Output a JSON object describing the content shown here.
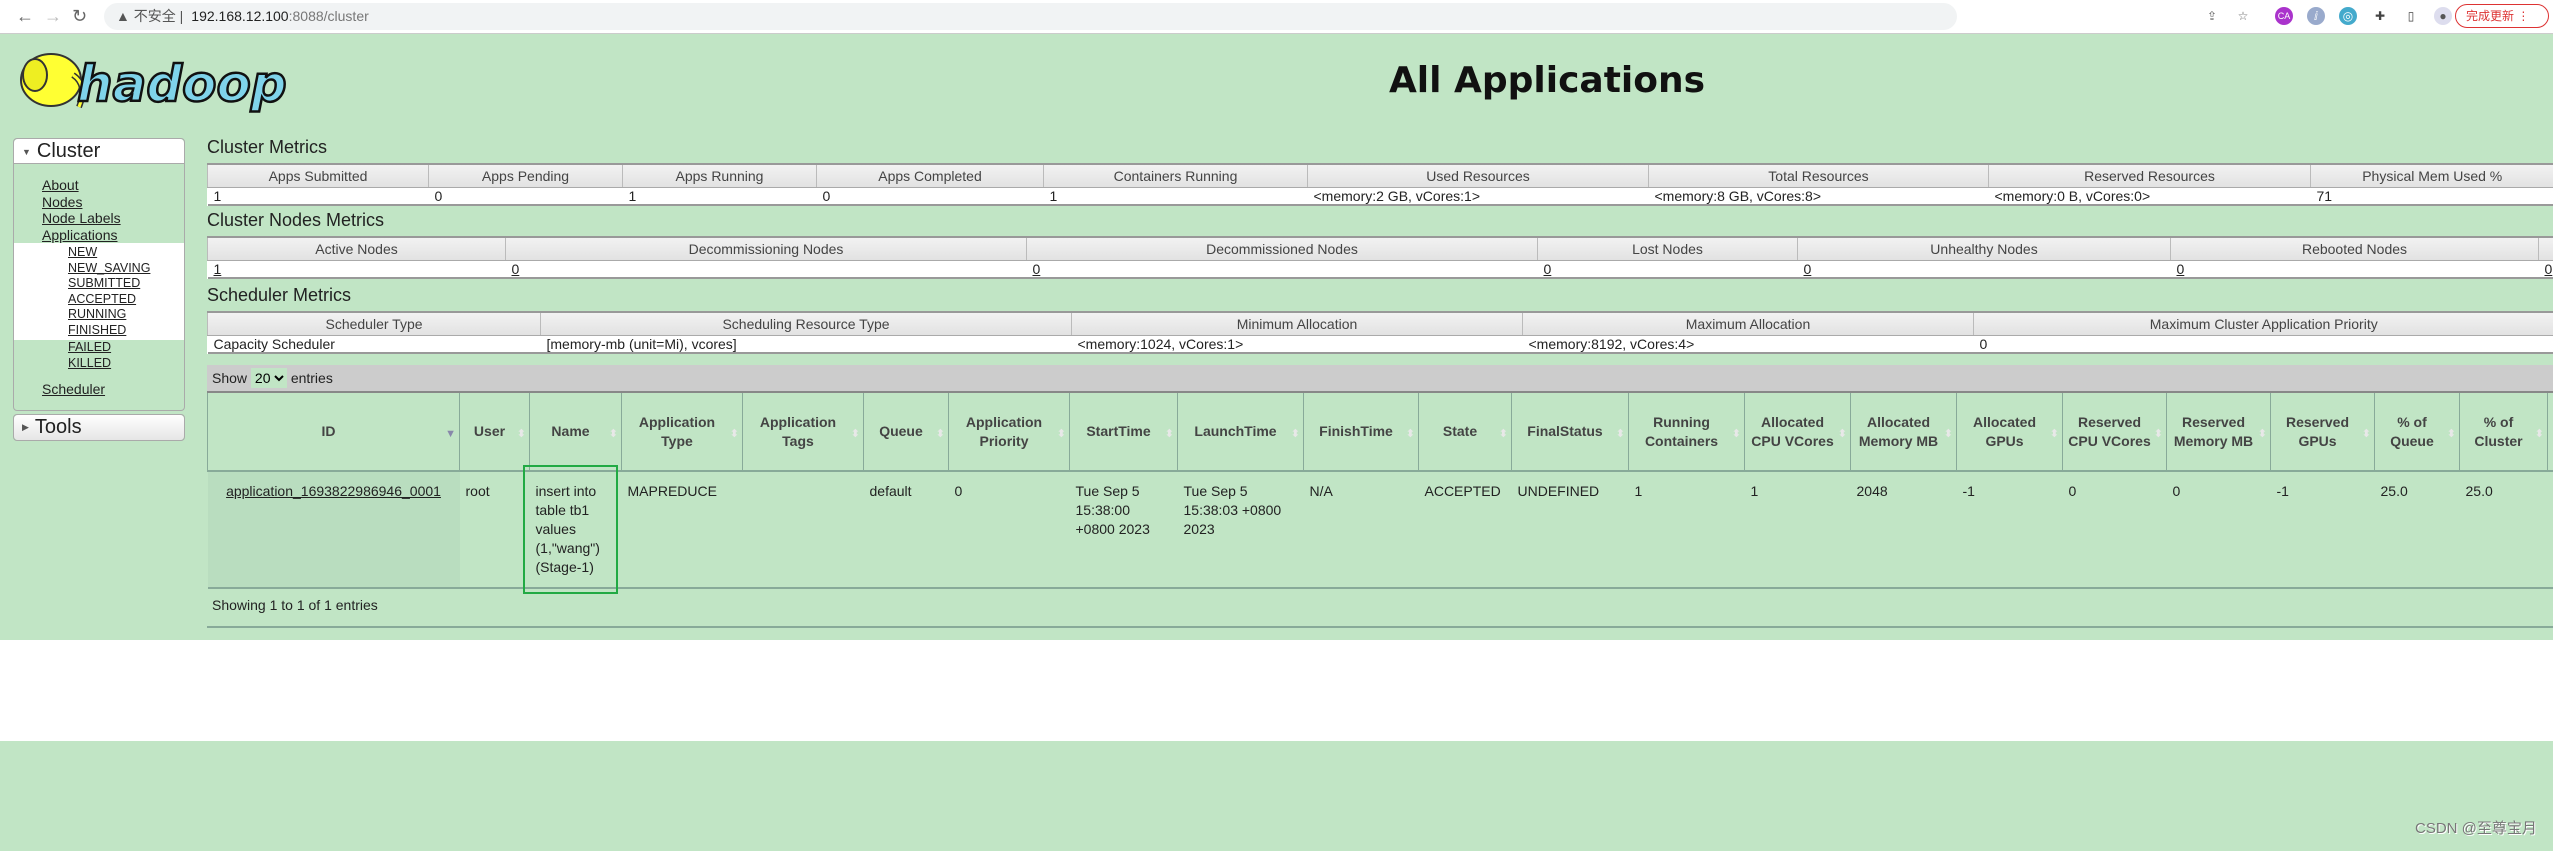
{
  "browser": {
    "insecure_label": "不安全",
    "url_host": "192.168.12.100",
    "url_path": ":8088/cluster",
    "update_button": "完成更新"
  },
  "logo_text": "hadoop",
  "page_title": "All Applications",
  "sidebar": {
    "cluster_label": "Cluster",
    "links": [
      "About",
      "Nodes",
      "Node Labels",
      "Applications"
    ],
    "app_states": [
      "NEW",
      "NEW_SAVING",
      "SUBMITTED",
      "ACCEPTED",
      "RUNNING",
      "FINISHED"
    ],
    "app_states2": [
      "FAILED",
      "KILLED"
    ],
    "scheduler": "Scheduler",
    "tools_label": "Tools"
  },
  "cluster_metrics": {
    "title": "Cluster Metrics",
    "headers": [
      "Apps Submitted",
      "Apps Pending",
      "Apps Running",
      "Apps Completed",
      "Containers Running",
      "Used Resources",
      "Total Resources",
      "Reserved Resources",
      "Physical Mem Used %"
    ],
    "values": [
      "1",
      "0",
      "1",
      "0",
      "1",
      "<memory:2 GB, vCores:1>",
      "<memory:8 GB, vCores:8>",
      "<memory:0 B, vCores:0>",
      "71"
    ]
  },
  "nodes_metrics": {
    "title": "Cluster Nodes Metrics",
    "headers": [
      "Active Nodes",
      "Decommissioning Nodes",
      "Decommissioned Nodes",
      "Lost Nodes",
      "Unhealthy Nodes",
      "Rebooted Nodes"
    ],
    "values": [
      "1",
      "0",
      "0",
      "0",
      "0",
      "0",
      "0"
    ]
  },
  "scheduler_metrics": {
    "title": "Scheduler Metrics",
    "headers": [
      "Scheduler Type",
      "Scheduling Resource Type",
      "Minimum Allocation",
      "Maximum Allocation",
      "Maximum Cluster Application Priority"
    ],
    "values": [
      "Capacity Scheduler",
      "[memory-mb (unit=Mi), vcores]",
      "<memory:1024, vCores:1>",
      "<memory:8192, vCores:4>",
      "0"
    ]
  },
  "apps_table": {
    "show_label": "Show",
    "entries_label": "entries",
    "page_size": "20",
    "headers": [
      "ID",
      "User",
      "Name",
      "Application Type",
      "Application Tags",
      "Queue",
      "Application Priority",
      "StartTime",
      "LaunchTime",
      "FinishTime",
      "State",
      "FinalStatus",
      "Running Containers",
      "Allocated CPU VCores",
      "Allocated Memory MB",
      "Allocated GPUs",
      "Reserved CPU VCores",
      "Reserved Memory MB",
      "Reserved GPUs",
      "% of Queue",
      "% of Cluster"
    ],
    "rows": [
      [
        "application_1693822986946_0001",
        "root",
        "insert into table tb1 values (1,\"wang\")(Stage-1)",
        "MAPREDUCE",
        "",
        "default",
        "0",
        "Tue Sep 5 15:38:00 +0800 2023",
        "Tue Sep 5 15:38:03 +0800 2023",
        "N/A",
        "ACCEPTED",
        "UNDEFINED",
        "1",
        "1",
        "2048",
        "-1",
        "0",
        "0",
        "-1",
        "25.0",
        "25.0"
      ]
    ],
    "info": "Showing 1 to 1 of 1 entries"
  },
  "watermark": "CSDN @至尊宝月"
}
